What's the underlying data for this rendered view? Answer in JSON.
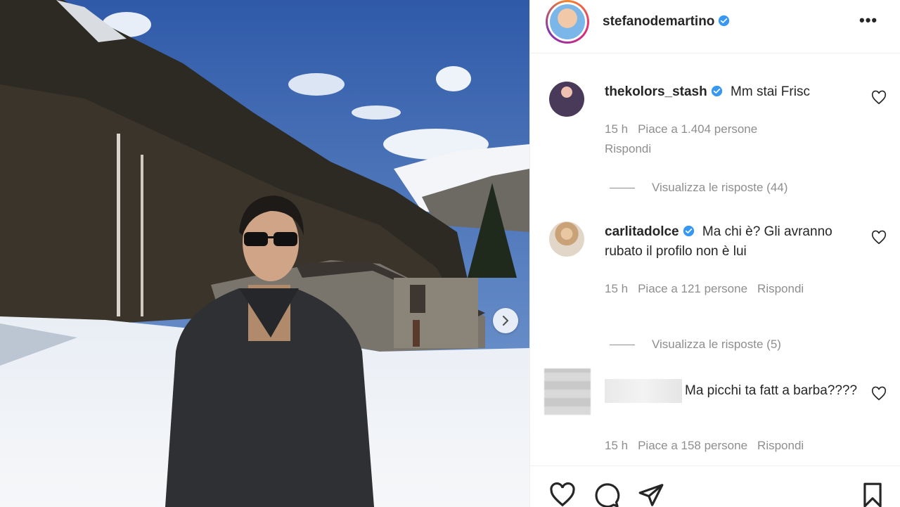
{
  "post": {
    "author": "stefanodemartino",
    "photo_alt": "",
    "next_label": "›"
  },
  "header": {
    "username": "stefanodemartino",
    "more_label": "•••"
  },
  "comments": [
    {
      "user": "thekolors_stash",
      "verified": true,
      "text": "Mm stai Frisc",
      "time": "15 h",
      "likes": "Piace a 1.404 persone",
      "reply": "Rispondi",
      "view_replies": "Visualizza le risposte (44)"
    },
    {
      "user": "carlitadolce",
      "verified": true,
      "text": "Ma chi è? Gli avranno rubato il profilo non è lui",
      "time": "15 h",
      "likes": "Piace a 121 persone",
      "reply": "Rispondi",
      "view_replies": "Visualizza le risposte (5)"
    },
    {
      "user": "",
      "verified": false,
      "text": "Ma picchi ta fatt a barba????",
      "time": "15 h",
      "likes": "Piace a 158 persone",
      "reply": "Rispondi"
    }
  ],
  "colors": {
    "verified": "#3897f0",
    "meta_text": "#8e8e8e",
    "primary_text": "#262626"
  }
}
